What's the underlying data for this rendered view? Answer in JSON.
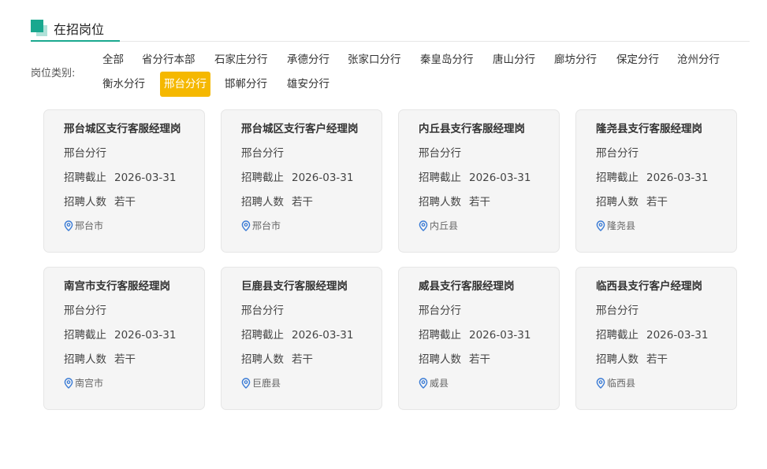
{
  "section": {
    "title": "在招岗位"
  },
  "filter": {
    "label": "岗位类别:",
    "options": [
      "全部",
      "省分行本部",
      "石家庄分行",
      "承德分行",
      "张家口分行",
      "秦皇岛分行",
      "唐山分行",
      "廊坊分行",
      "保定分行",
      "沧州分行",
      "衡水分行",
      "邢台分行",
      "邯郸分行",
      "雄安分行"
    ],
    "selected": "邢台分行"
  },
  "fields": {
    "deadline_label": "招聘截止",
    "count_label": "招聘人数"
  },
  "jobs": [
    {
      "title": "邢台城区支行客服经理岗",
      "branch": "邢台分行",
      "deadline": "2026-03-31",
      "count": "若干",
      "location": "邢台市"
    },
    {
      "title": "邢台城区支行客户经理岗",
      "branch": "邢台分行",
      "deadline": "2026-03-31",
      "count": "若干",
      "location": "邢台市"
    },
    {
      "title": "内丘县支行客服经理岗",
      "branch": "邢台分行",
      "deadline": "2026-03-31",
      "count": "若干",
      "location": "内丘县"
    },
    {
      "title": "隆尧县支行客服经理岗",
      "branch": "邢台分行",
      "deadline": "2026-03-31",
      "count": "若干",
      "location": "隆尧县"
    },
    {
      "title": "南宫市支行客服经理岗",
      "branch": "邢台分行",
      "deadline": "2026-03-31",
      "count": "若干",
      "location": "南宫市"
    },
    {
      "title": "巨鹿县支行客服经理岗",
      "branch": "邢台分行",
      "deadline": "2026-03-31",
      "count": "若干",
      "location": "巨鹿县"
    },
    {
      "title": "威县支行客服经理岗",
      "branch": "邢台分行",
      "deadline": "2026-03-31",
      "count": "若干",
      "location": "威县"
    },
    {
      "title": "临西县支行客户经理岗",
      "branch": "邢台分行",
      "deadline": "2026-03-31",
      "count": "若干",
      "location": "临西县"
    }
  ],
  "colors": {
    "accent": "#1aa88f",
    "selected": "#f5b800",
    "pin": "#3a7bd5"
  },
  "icons": {
    "location": "location-pin-icon"
  }
}
